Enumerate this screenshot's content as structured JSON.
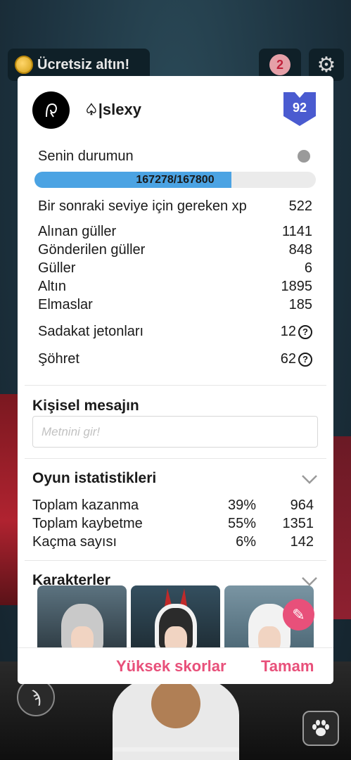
{
  "top_bar": {
    "free_gold_label": "Ücretsiz altın!",
    "notification_count": "2"
  },
  "profile": {
    "username": "♤|slexy",
    "level": "92"
  },
  "status": {
    "title": "Senin durumun",
    "xp_text": "167278/167800",
    "xp_progress_fraction": 0.7
  },
  "stats": {
    "next_level_label": "Bir sonraki seviye için gereken xp",
    "next_level_value": "522",
    "received_roses_label": "Alınan güller",
    "received_roses_value": "1141",
    "sent_roses_label": "Gönderilen güller",
    "sent_roses_value": "848",
    "roses_label": "Güller",
    "roses_value": "6",
    "gold_label": "Altın",
    "gold_value": "1895",
    "diamonds_label": "Elmaslar",
    "diamonds_value": "185",
    "loyalty_label": "Sadakat jetonları",
    "loyalty_value": "12",
    "fame_label": "Şöhret",
    "fame_value": "62"
  },
  "personal_message": {
    "title": "Kişisel mesajın",
    "placeholder": "Metnini gir!"
  },
  "game_stats": {
    "title": "Oyun istatistikleri",
    "rows": [
      {
        "label": "Toplam kazanma",
        "percent": "39%",
        "value": "964"
      },
      {
        "label": "Toplam kaybetme",
        "percent": "55%",
        "value": "1351"
      },
      {
        "label": "Kaçma sayısı",
        "percent": "6%",
        "value": "142"
      }
    ]
  },
  "characters": {
    "title": "Karakterler"
  },
  "footer": {
    "highscores_label": "Yüksek skorlar",
    "ok_label": "Tamam"
  },
  "colors": {
    "accent": "#e8507a",
    "xp_fill": "#4ba3e3",
    "level_badge": "#4a5bd0"
  }
}
